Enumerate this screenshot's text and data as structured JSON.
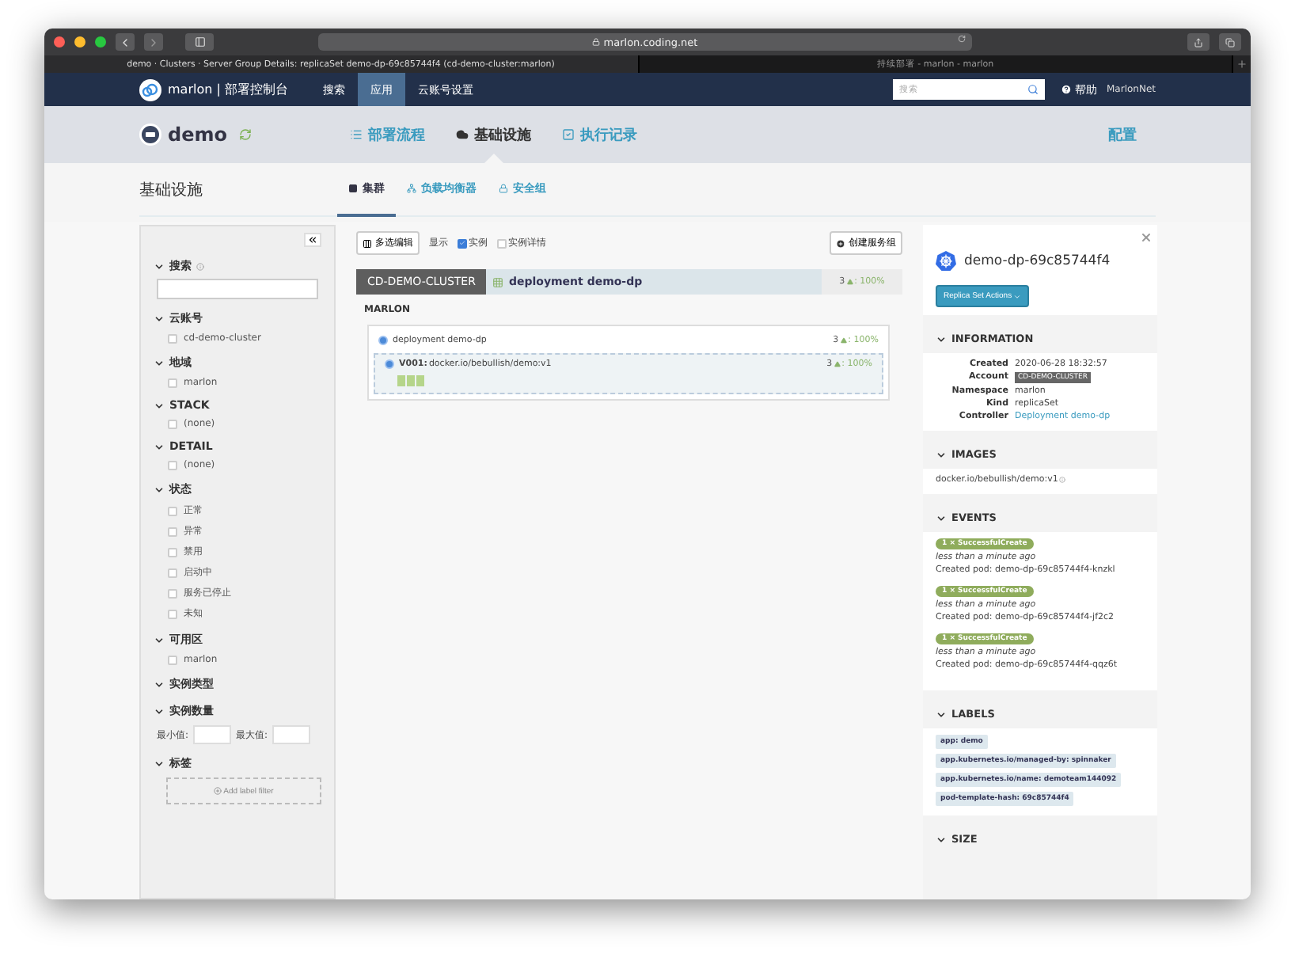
{
  "browser": {
    "url": "marlon.coding.net",
    "tabs": [
      {
        "label": "demo · Clusters · Server Group Details: replicaSet demo-dp-69c85744f4 (cd-demo-cluster:marlon)",
        "selected": true
      },
      {
        "label": "持续部署 - marlon - marlon",
        "selected": false
      }
    ]
  },
  "navbar": {
    "brand": "marlon | 部署控制台",
    "items": [
      {
        "label": "搜索",
        "selected": false
      },
      {
        "label": "应用",
        "selected": true
      },
      {
        "label": "云账号设置",
        "selected": false
      }
    ],
    "search": {
      "placeholder": "搜索"
    },
    "help": "帮助",
    "user": "MarlonNet"
  },
  "app_header": {
    "name": "demo",
    "tabs": [
      {
        "label": "部署流程",
        "kind": "list",
        "selected": false
      },
      {
        "label": "基础设施",
        "kind": "cloud",
        "selected": true
      },
      {
        "label": "执行记录",
        "kind": "check",
        "selected": false
      }
    ],
    "config": "配置"
  },
  "section": {
    "title": "基础设施",
    "tabs": [
      {
        "label": "集群",
        "kind": "grid",
        "selected": true
      },
      {
        "label": "负载均衡器",
        "kind": "network",
        "selected": false
      },
      {
        "label": "安全组",
        "kind": "lock",
        "selected": false
      }
    ]
  },
  "filters": [
    {
      "kind": "search",
      "title": "搜索",
      "expanded": true
    },
    {
      "kind": "checklist",
      "title": "云账号",
      "expanded": true,
      "items": [
        {
          "label": "cd-demo-cluster",
          "checked": false
        }
      ]
    },
    {
      "kind": "checklist",
      "title": "地域",
      "expanded": true,
      "items": [
        {
          "label": "marlon",
          "checked": false
        }
      ]
    },
    {
      "kind": "checklist",
      "title": "STACK",
      "expanded": true,
      "items": [
        {
          "label": "(none)",
          "checked": false
        }
      ]
    },
    {
      "kind": "checklist",
      "title": "DETAIL",
      "expanded": true,
      "items": [
        {
          "label": "(none)",
          "checked": false
        }
      ]
    },
    {
      "kind": "checklist",
      "title": "状态",
      "expanded": true,
      "items": [
        {
          "label": "正常",
          "checked": false
        },
        {
          "label": "异常",
          "checked": false
        },
        {
          "label": "禁用",
          "checked": false
        },
        {
          "label": "启动中",
          "checked": false
        },
        {
          "label": "服务已停止",
          "checked": false
        },
        {
          "label": "未知",
          "checked": false
        }
      ]
    },
    {
      "kind": "checklist",
      "title": "可用区",
      "expanded": true,
      "items": [
        {
          "label": "marlon",
          "checked": false
        }
      ]
    },
    {
      "kind": "checklist",
      "title": "实例类型",
      "expanded": true
    },
    {
      "kind": "range",
      "title": "实例数量",
      "expanded": true,
      "min_label": "最小值:",
      "max_label": "最大值:"
    },
    {
      "kind": "labels",
      "title": "标签",
      "expanded": true,
      "button": "Add label filter"
    }
  ],
  "toolbar": {
    "multi_edit": "多选编辑",
    "show_label": "显示",
    "options": [
      {
        "label": "实例",
        "checked": true
      },
      {
        "label": "实例详情",
        "checked": false
      }
    ],
    "create": "创建服务组"
  },
  "cluster": {
    "account": "CD-DEMO-CLUSTER",
    "name": "deployment demo-dp",
    "count": "3",
    "health": ": 100%",
    "region": "MARLON",
    "deployment": {
      "name": "deployment demo-dp",
      "count": "3",
      "health": ": 100%"
    },
    "server_group": {
      "version": "V001:",
      "image": "docker.io/bebullish/demo:v1",
      "count": "3",
      "health": ": 100%",
      "instances": [
        {
          "kind": "up"
        },
        {
          "kind": "up"
        },
        {
          "kind": "up"
        }
      ]
    }
  },
  "details": {
    "title": "demo-dp-69c85744f4",
    "actions": "Replica Set Actions",
    "sections": [
      {
        "kind": "info",
        "title": "INFORMATION",
        "expanded": true,
        "rows": [
          {
            "label": "Created",
            "value": "2020-06-28 18:32:57",
            "kind": "text"
          },
          {
            "label": "Account",
            "value": "CD-DEMO-CLUSTER",
            "kind": "badge"
          },
          {
            "label": "Namespace",
            "value": "marlon",
            "kind": "text"
          },
          {
            "label": "Kind",
            "value": "replicaSet",
            "kind": "text"
          },
          {
            "label": "Controller",
            "value": "Deployment demo-dp",
            "kind": "link"
          }
        ]
      },
      {
        "kind": "images",
        "title": "IMAGES",
        "expanded": true,
        "images": [
          "docker.io/bebullish/demo:v1"
        ]
      },
      {
        "kind": "events",
        "title": "EVENTS",
        "expanded": true,
        "events": [
          {
            "badge": "1 × SuccessfulCreate",
            "time": "less than a minute ago",
            "message": "Created pod: demo-dp-69c85744f4-knzkl"
          },
          {
            "badge": "1 × SuccessfulCreate",
            "time": "less than a minute ago",
            "message": "Created pod: demo-dp-69c85744f4-jf2c2"
          },
          {
            "badge": "1 × SuccessfulCreate",
            "time": "less than a minute ago",
            "message": "Created pod: demo-dp-69c85744f4-qqz6t"
          }
        ]
      },
      {
        "kind": "labels",
        "title": "LABELS",
        "expanded": true,
        "labels": [
          "app: demo",
          "app.kubernetes.io/managed-by: spinnaker",
          "app.kubernetes.io/name: demoteam144092",
          "pod-template-hash: 69c85744f4"
        ]
      },
      {
        "kind": "size",
        "title": "SIZE",
        "expanded": true
      }
    ]
  }
}
